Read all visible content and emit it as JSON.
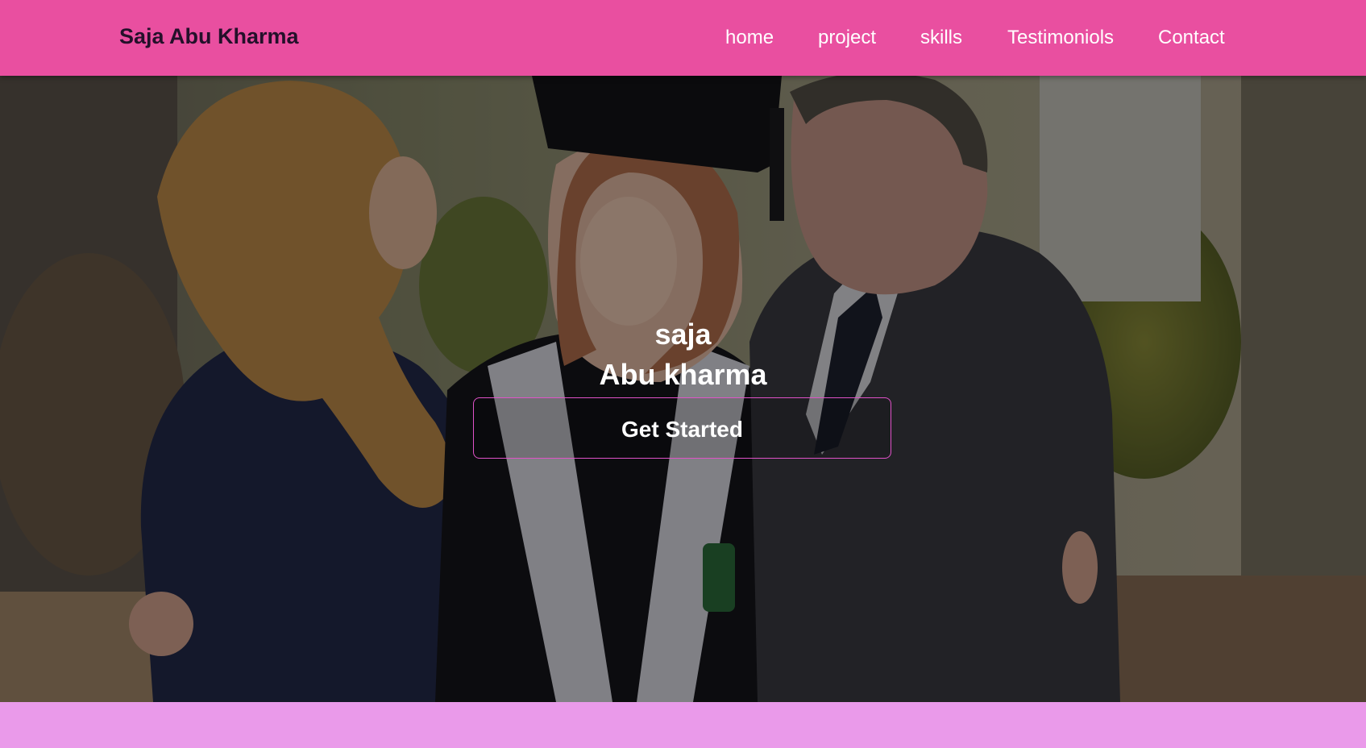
{
  "brand": {
    "name": "Saja Abu Kharma"
  },
  "nav": {
    "items": [
      "home",
      "project",
      "skills",
      "Testimoniols",
      "Contact"
    ]
  },
  "hero": {
    "photo_description_icon": "graduation-photo",
    "name_line1": "saja",
    "name_line2": "Abu kharma",
    "cta_label": "Get Started"
  },
  "colors": {
    "navbar": "#e94fa0",
    "page_background": "#ea9aea",
    "button_border": "#e052c8",
    "brand_text": "#24102a"
  }
}
